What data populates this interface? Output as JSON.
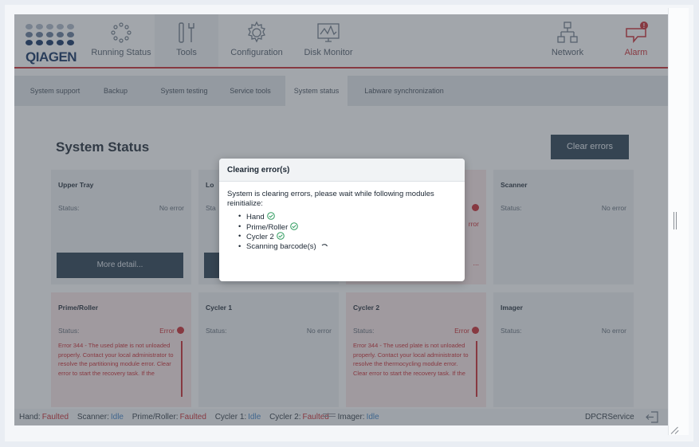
{
  "nav": {
    "brand": "QIAGEN",
    "items": [
      {
        "label": "Running Status",
        "icon": "running-status-icon"
      },
      {
        "label": "Tools",
        "icon": "tools-icon"
      },
      {
        "label": "Configuration",
        "icon": "gear-icon"
      },
      {
        "label": "Disk Monitor",
        "icon": "disk-monitor-icon"
      }
    ],
    "network_label": "Network",
    "alarm_label": "Alarm",
    "alarm_count": "!"
  },
  "subtabs": [
    "System support",
    "Backup",
    "System testing",
    "Service tools",
    "System status",
    "Labware synchronization"
  ],
  "page": {
    "title": "System Status",
    "clear_errors": "Clear errors"
  },
  "cards": {
    "upper_tray": {
      "title": "Upper Tray",
      "status_label": "Status:",
      "status": "No error",
      "more": "More detail..."
    },
    "lower_tray": {
      "title": "Lo",
      "status_label": "Sta"
    },
    "hand": {
      "status_tail": "rror",
      "more_tail": "..."
    },
    "scanner": {
      "title": "Scanner",
      "status_label": "Status:",
      "status": "No error"
    },
    "prime_roller": {
      "title": "Prime/Roller",
      "status_label": "Status:",
      "status": "Error",
      "message": "Error 344 - The used plate is not unloaded properly. Contact your local administrator to resolve the partitioning module error. Clear error to start the recovery task. If the"
    },
    "cycler1": {
      "title": "Cycler 1",
      "status_label": "Status:",
      "status": "No error"
    },
    "cycler2": {
      "title": "Cycler 2",
      "status_label": "Status:",
      "status": "Error",
      "message": "Error 344 - The used plate is not unloaded properly. Contact your local administrator to resolve the thermocycling module error. Clear error to start the recovery task. If the"
    },
    "imager": {
      "title": "Imager",
      "status_label": "Status:",
      "status": "No error"
    }
  },
  "statusbar": {
    "hand_label": "Hand:",
    "hand": "Faulted",
    "scanner_label": "Scanner:",
    "scanner": "Idle",
    "prime_label": "Prime/Roller:",
    "prime": "Faulted",
    "cycler1_label": "Cycler 1:",
    "cycler1": "Idle",
    "cycler2_label": "Cycler 2:",
    "cycler2": "Faulted",
    "imager_label": "Imager:",
    "imager": "Idle",
    "user": "DPCRService"
  },
  "dialog": {
    "title": "Clearing error(s)",
    "message": "System is clearing errors, please wait while following modules reinitialize:",
    "modules": [
      {
        "name": "Hand",
        "state": "done"
      },
      {
        "name": "Prime/Roller",
        "state": "done"
      },
      {
        "name": "Cycler 2",
        "state": "done"
      },
      {
        "name": "Scanning barcode(s)",
        "state": "in-progress"
      }
    ]
  },
  "colors": {
    "brand": "#0d2d5e",
    "accent_red": "#c9242b",
    "button_dark": "#243a4d",
    "idle_blue": "#3b7fc4",
    "success_green": "#2e9b5e"
  }
}
